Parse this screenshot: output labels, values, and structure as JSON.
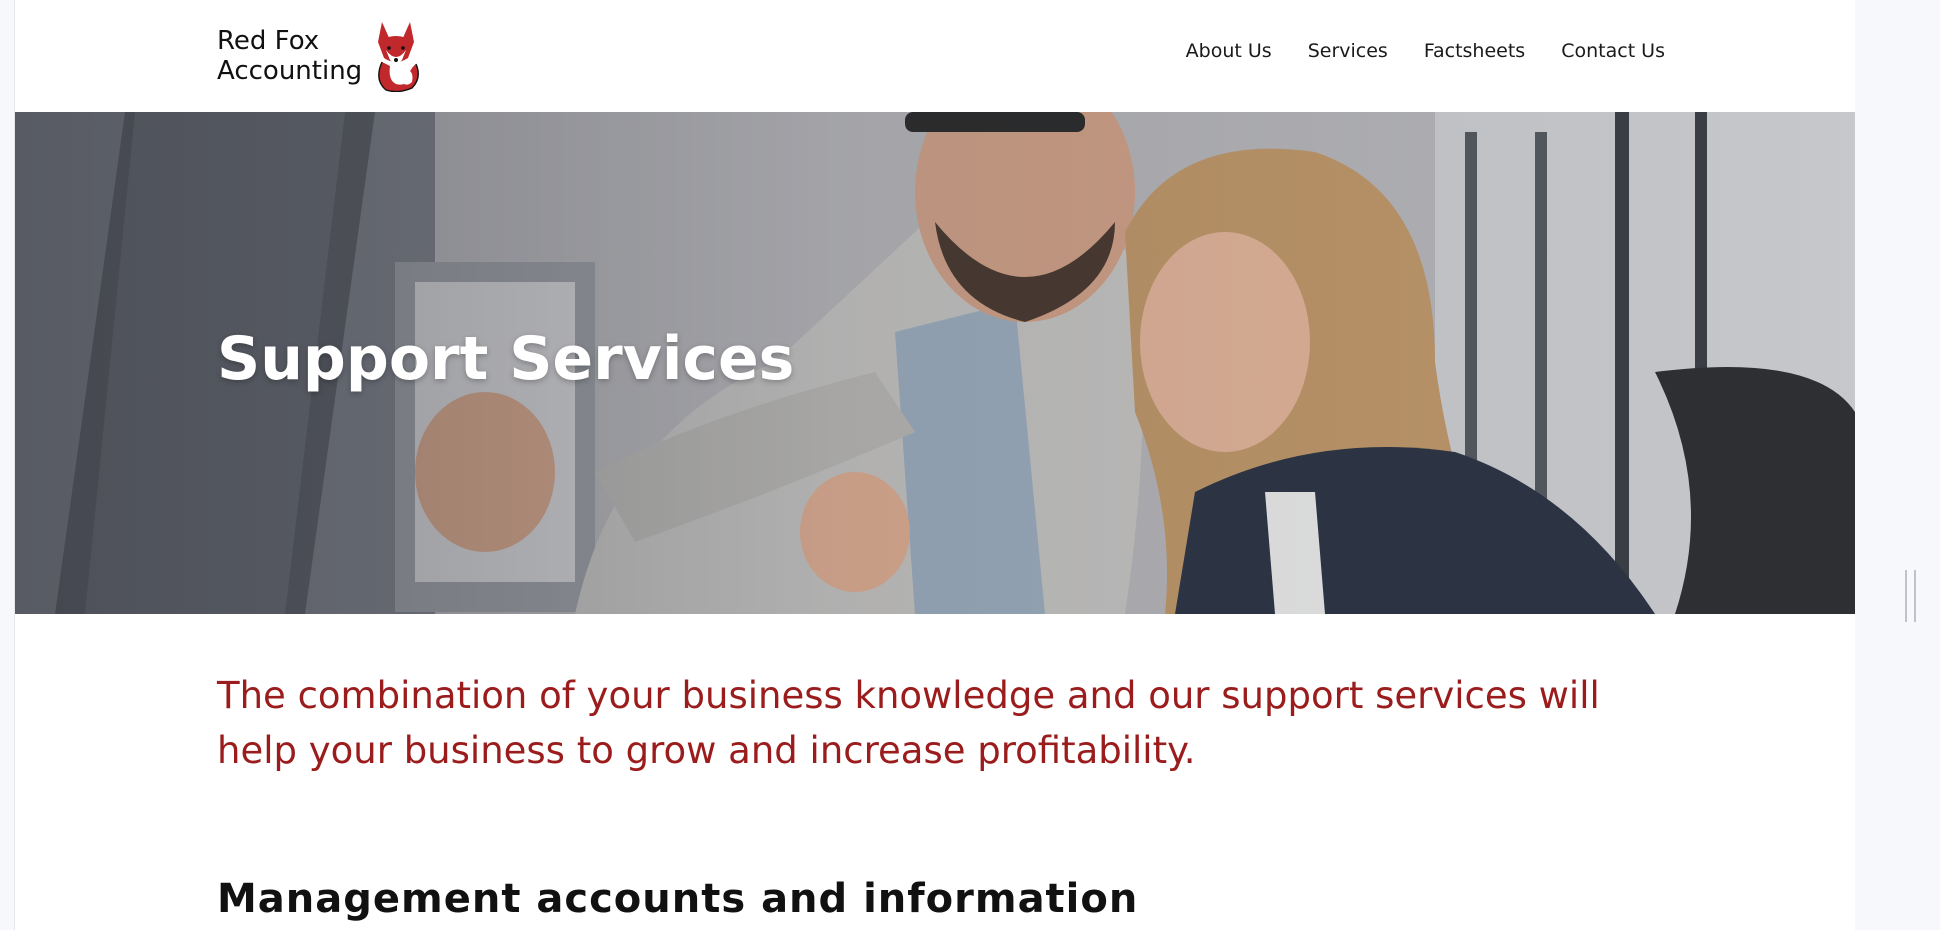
{
  "brand": {
    "line1": "Red Fox",
    "line2": "Accounting",
    "logo_icon": "fox-icon",
    "accent_color": "#c0282b"
  },
  "nav": {
    "items": [
      {
        "label": "About Us"
      },
      {
        "label": "Services"
      },
      {
        "label": "Factsheets"
      },
      {
        "label": "Contact Us"
      }
    ]
  },
  "hero": {
    "title": "Support Services"
  },
  "intro": {
    "text": "The combination of your business knowledge and our support services will help your business to grow and increase profitability.",
    "color": "#9b1c1c"
  },
  "section": {
    "heading": "Management accounts and information"
  }
}
